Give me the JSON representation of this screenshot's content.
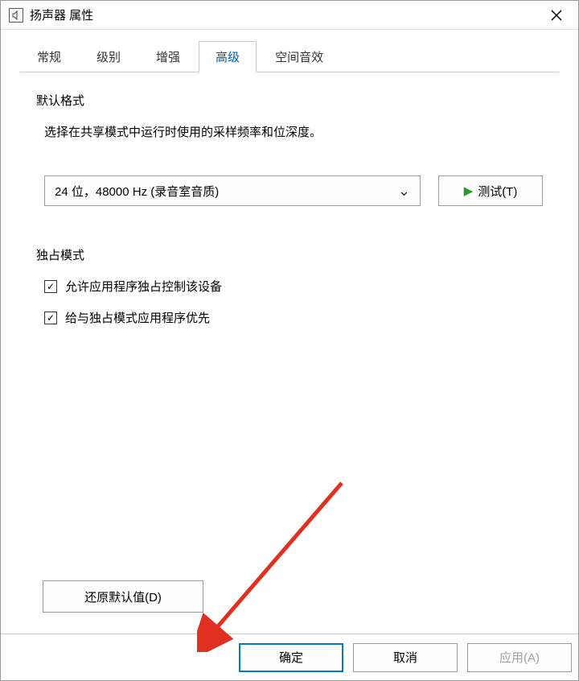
{
  "window": {
    "title": "扬声器 属性"
  },
  "tabs": {
    "items": [
      {
        "label": "常规",
        "active": false
      },
      {
        "label": "级别",
        "active": false
      },
      {
        "label": "增强",
        "active": false
      },
      {
        "label": "高级",
        "active": true
      },
      {
        "label": "空间音效",
        "active": false
      }
    ]
  },
  "default_format": {
    "group_label": "默认格式",
    "desc": "选择在共享模式中运行时使用的采样频率和位深度。",
    "select_value": "24 位，48000 Hz (录音室音质)",
    "test_label": "测试(T)"
  },
  "exclusive_mode": {
    "group_label": "独占模式",
    "allow_exclusive": {
      "label": "允许应用程序独占控制该设备",
      "checked": true
    },
    "give_priority": {
      "label": "给与独占模式应用程序优先",
      "checked": true
    }
  },
  "restore_label": "还原默认值(D)",
  "footer": {
    "ok": "确定",
    "cancel": "取消",
    "apply": "应用(A)"
  }
}
